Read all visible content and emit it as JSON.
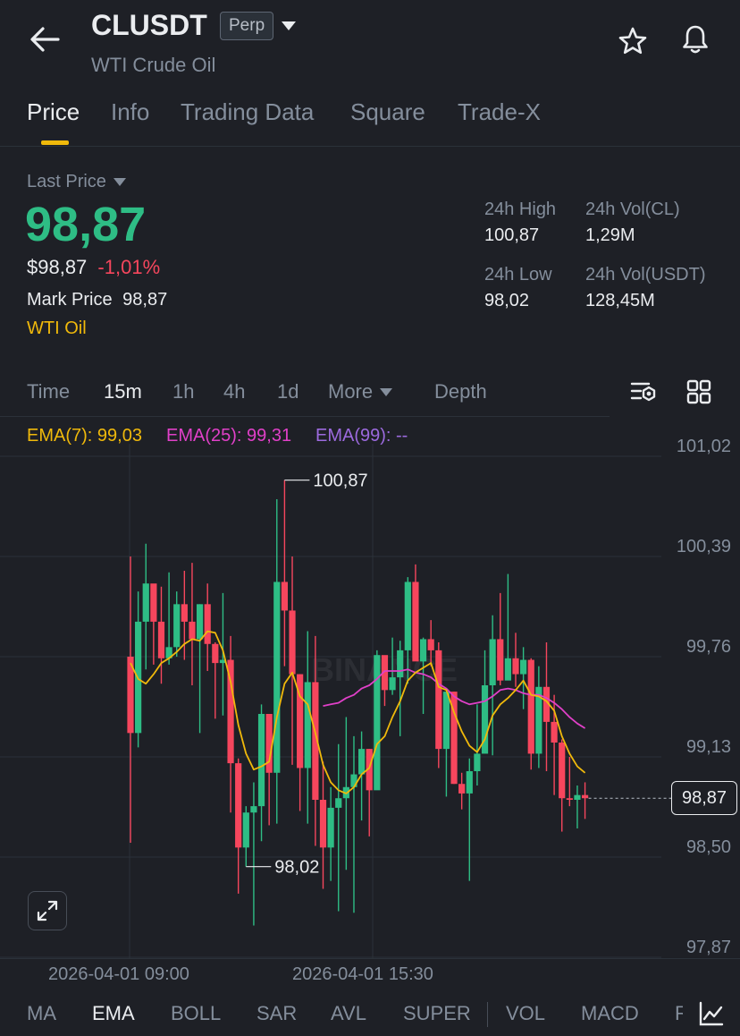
{
  "header": {
    "symbol": "CLUSDT",
    "contract_badge": "Perp",
    "subtitle": "WTI Crude Oil",
    "icons": [
      "back-arrow-icon",
      "caret-down-icon",
      "star-icon",
      "bell-icon"
    ]
  },
  "tabs": [
    {
      "label": "Price",
      "active": true
    },
    {
      "label": "Info",
      "active": false
    },
    {
      "label": "Trading Data",
      "active": false
    },
    {
      "label": "Square",
      "active": false
    },
    {
      "label": "Trade-X",
      "active": false
    }
  ],
  "price": {
    "last_price_label": "Last Price",
    "last_price": "98,87",
    "usd_price": "$98,87",
    "change_pct": "-1,01%",
    "mark_price_label": "Mark Price",
    "mark_price": "98,87",
    "tag": "WTI Oil"
  },
  "stats": {
    "high_label": "24h High",
    "high": "100,87",
    "vol_cl_label": "24h Vol(CL)",
    "vol_cl": "1,29M",
    "low_label": "24h Low",
    "low": "98,02",
    "vol_usdt_label": "24h Vol(USDT)",
    "vol_usdt": "128,45M"
  },
  "timeframes": {
    "time": "Time",
    "m15": "15m",
    "h1": "1h",
    "h4": "4h",
    "d1": "1d",
    "more": "More",
    "depth": "Depth",
    "active": "15m"
  },
  "ema": {
    "ema7": "EMA(7): 99,03",
    "ema25": "EMA(25): 99,31",
    "ema99": "EMA(99): --"
  },
  "colors": {
    "up": "#2ebd85",
    "down": "#f6465d",
    "accent": "#f0b90b",
    "ema7": "#f0b90b",
    "ema25": "#e040c8",
    "ema99": "#9c6ade"
  },
  "chart_data": {
    "type": "candlestick",
    "symbol": "CLUSDT",
    "interval": "15m",
    "y_ticks": [
      "101,02",
      "100,39",
      "99,76",
      "99,13",
      "98,50",
      "97,87"
    ],
    "ylim": [
      97.87,
      101.02
    ],
    "x_ticks": [
      "2026-04-01 09:00",
      "2026-04-01 15:30"
    ],
    "high_marker": "100,87",
    "low_marker": "98,02",
    "current_price_tag": "98,87",
    "watermark": "BINANCE",
    "candles": [
      [
        99.76,
        99.28,
        100.39,
        98.59
      ],
      [
        99.28,
        99.98,
        100.17,
        99.19
      ],
      [
        99.98,
        100.22,
        100.47,
        99.68
      ],
      [
        100.22,
        99.98,
        100.16,
        99.71
      ],
      [
        99.98,
        99.75,
        100.2,
        99.59
      ],
      [
        99.75,
        99.82,
        100.29,
        99.71
      ],
      [
        99.82,
        100.09,
        100.17,
        99.76
      ],
      [
        100.09,
        99.98,
        100.3,
        99.74
      ],
      [
        99.98,
        99.87,
        100.35,
        99.58
      ],
      [
        99.87,
        100.09,
        100.09,
        99.28
      ],
      [
        100.09,
        99.84,
        100.22,
        99.67
      ],
      [
        99.84,
        99.72,
        99.85,
        99.37
      ],
      [
        99.72,
        99.74,
        100.16,
        99.39
      ],
      [
        99.74,
        99.09,
        99.89,
        98.78
      ],
      [
        99.09,
        98.56,
        99.12,
        98.27
      ],
      [
        98.56,
        98.78,
        98.82,
        98.44
      ],
      [
        98.78,
        98.82,
        98.97,
        98.07
      ],
      [
        98.82,
        99.4,
        99.46,
        98.6
      ],
      [
        99.4,
        99.03,
        99.4,
        98.7
      ],
      [
        99.03,
        100.23,
        100.75,
        98.71
      ],
      [
        100.23,
        100.05,
        100.87,
        99.7
      ],
      [
        100.05,
        99.65,
        100.39,
        99.08
      ],
      [
        99.65,
        99.06,
        99.65,
        98.79
      ],
      [
        99.06,
        99.6,
        99.92,
        98.71
      ],
      [
        99.6,
        98.86,
        99.89,
        98.57
      ],
      [
        98.86,
        98.56,
        99.1,
        98.3
      ],
      [
        98.56,
        98.81,
        98.94,
        98.35
      ],
      [
        98.81,
        98.87,
        99.21,
        98.16
      ],
      [
        98.87,
        98.94,
        99.38,
        98.42
      ],
      [
        98.94,
        99.02,
        99.26,
        98.15
      ],
      [
        99.02,
        99.18,
        99.29,
        98.73
      ],
      [
        99.18,
        98.92,
        99.18,
        98.63
      ],
      [
        98.92,
        99.77,
        99.8,
        99.06
      ],
      [
        99.77,
        99.55,
        99.75,
        99.45
      ],
      [
        99.55,
        99.63,
        99.88,
        99.52
      ],
      [
        99.63,
        99.8,
        99.86,
        99.26
      ],
      [
        99.8,
        100.23,
        100.26,
        99.59
      ],
      [
        100.23,
        99.73,
        100.34,
        99.74
      ],
      [
        99.73,
        99.87,
        99.88,
        99.4
      ],
      [
        99.87,
        99.8,
        99.99,
        99.7
      ],
      [
        99.8,
        99.18,
        99.85,
        99.06
      ],
      [
        99.18,
        99.54,
        99.54,
        98.88
      ],
      [
        99.54,
        98.96,
        99.54,
        98.96
      ],
      [
        98.96,
        98.9,
        99.03,
        98.8
      ],
      [
        98.9,
        99.04,
        99.12,
        98.35
      ],
      [
        99.04,
        99.15,
        99.46,
        98.95
      ],
      [
        99.15,
        99.58,
        99.8,
        99.26
      ],
      [
        99.58,
        99.87,
        100.02,
        99.14
      ],
      [
        99.87,
        99.61,
        100.16,
        99.58
      ],
      [
        99.61,
        99.75,
        100.28,
        99.65
      ],
      [
        99.75,
        99.65,
        99.91,
        99.57
      ],
      [
        99.65,
        99.74,
        99.82,
        99.43
      ],
      [
        99.74,
        99.15,
        99.75,
        99.05
      ],
      [
        99.15,
        99.57,
        99.7,
        99.06
      ],
      [
        99.57,
        99.35,
        99.85,
        99.04
      ],
      [
        99.35,
        99.22,
        99.52,
        98.89
      ],
      [
        99.22,
        98.87,
        99.24,
        98.66
      ],
      [
        98.87,
        98.86,
        99.13,
        98.82
      ],
      [
        98.86,
        98.89,
        98.95,
        98.68
      ],
      [
        98.89,
        98.87,
        98.97,
        98.74
      ]
    ],
    "ema7": [
      99.72,
      99.62,
      99.59,
      99.65,
      99.72,
      99.75,
      99.79,
      99.84,
      99.87,
      99.86,
      99.92,
      99.91,
      99.8,
      99.6,
      99.33,
      99.15,
      99.05,
      99.07,
      99.1,
      99.38,
      99.59,
      99.66,
      99.51,
      99.46,
      99.28,
      99.08,
      98.97,
      98.92,
      98.9,
      98.94,
      99.02,
      99.06,
      99.21,
      99.26,
      99.38,
      99.48,
      99.61,
      99.66,
      99.69,
      99.72,
      99.57,
      99.55,
      99.41,
      99.29,
      99.2,
      99.16,
      99.24,
      99.39,
      99.46,
      99.5,
      99.55,
      99.61,
      99.52,
      99.51,
      99.48,
      99.42,
      99.26,
      99.15,
      99.07,
      99.03
    ],
    "ema25": [
      null,
      null,
      null,
      null,
      null,
      null,
      null,
      null,
      null,
      null,
      null,
      null,
      null,
      null,
      null,
      null,
      null,
      null,
      null,
      null,
      null,
      null,
      null,
      null,
      null,
      99.45,
      99.46,
      99.47,
      99.5,
      99.52,
      99.56,
      99.58,
      99.62,
      99.67,
      99.67,
      99.67,
      99.68,
      99.66,
      99.65,
      99.63,
      99.59,
      99.56,
      99.51,
      99.48,
      99.46,
      99.47,
      99.48,
      99.51,
      99.55,
      99.56,
      99.55,
      99.53,
      99.52,
      99.52,
      99.5,
      99.47,
      99.43,
      99.38,
      99.34,
      99.31
    ]
  },
  "indicators": [
    {
      "label": "MA",
      "active": false
    },
    {
      "label": "EMA",
      "active": true
    },
    {
      "label": "BOLL",
      "active": false
    },
    {
      "label": "SAR",
      "active": false
    },
    {
      "label": "AVL",
      "active": false
    },
    {
      "label": "SUPER",
      "active": false
    },
    {
      "label": "VOL",
      "active": false
    },
    {
      "label": "MACD",
      "active": false
    },
    {
      "label": "RSI",
      "active": false
    }
  ]
}
